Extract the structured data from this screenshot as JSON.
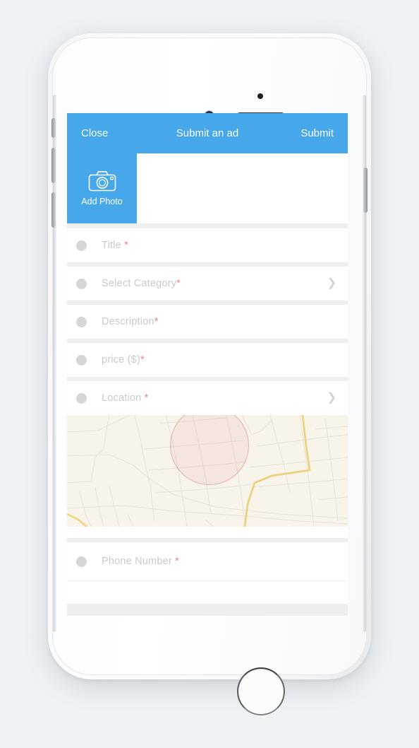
{
  "device": {
    "name": "white-smartphone",
    "hardware": {
      "silent_switch": "silent-switch",
      "volume_up": "volume-up-button",
      "volume_down": "volume-down-button",
      "power": "power-button",
      "home": "home-button",
      "front_camera": "front-camera",
      "earpiece_speaker": "earpiece-speaker",
      "proximity_sensor": "proximity-sensor"
    }
  },
  "theme": {
    "accent": "#46a7ea",
    "screen_bg": "#eceef0",
    "row_bg": "#ffffff",
    "placeholder": "#c9cacc",
    "required_mark": "#e8888f",
    "map_bg": "#f9f4e9",
    "map_road": "#f2d98a",
    "page_bg": "#eef2f5"
  },
  "navbar": {
    "close_label": "Close",
    "title": "Submit an ad",
    "submit_label": "Submit"
  },
  "photo": {
    "icon": "camera-icon",
    "add_photo_label": "Add Photo"
  },
  "form": {
    "required_mark": "*",
    "chevron": "❯",
    "fields": [
      {
        "name": "title",
        "label": "Title ",
        "required": true,
        "chevron": false,
        "value": "",
        "placeholder": "Title *"
      },
      {
        "name": "select-category",
        "label": "Select Category",
        "required": true,
        "chevron": true,
        "value": "",
        "placeholder": "Select Category*"
      },
      {
        "name": "description",
        "label": "Description",
        "required": true,
        "chevron": false,
        "value": "",
        "placeholder": "Description*"
      },
      {
        "name": "price",
        "label": "price ($)",
        "required": true,
        "chevron": false,
        "value": "",
        "placeholder": "price ($)*"
      },
      {
        "name": "location",
        "label": "Location ",
        "required": true,
        "chevron": true,
        "value": "",
        "placeholder": "Location *"
      },
      {
        "name": "phone-number",
        "label": "Phone Number ",
        "required": true,
        "chevron": false,
        "value": "",
        "placeholder": "Phone Number *"
      }
    ]
  },
  "map": {
    "name": "location-map",
    "radius_circle": "selected-area-circle"
  }
}
